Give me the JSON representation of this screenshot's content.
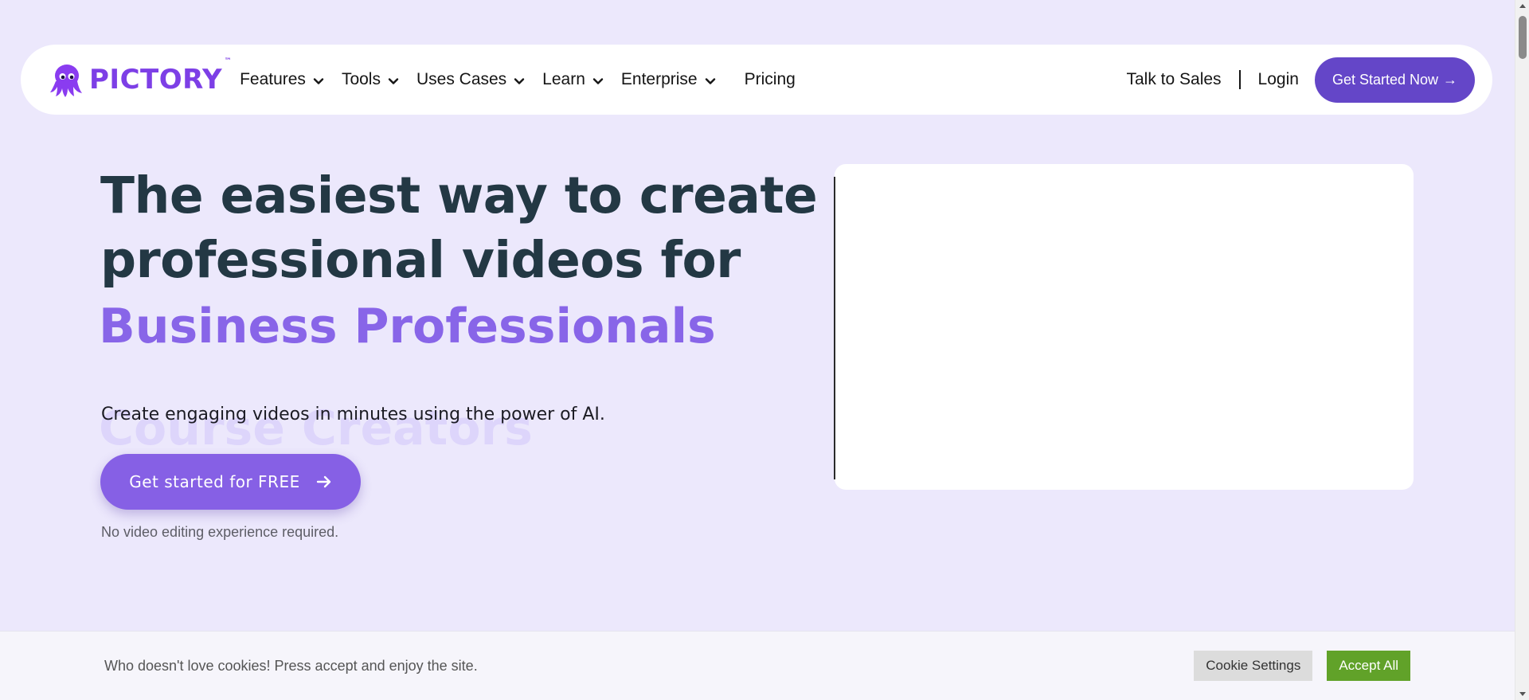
{
  "brand": {
    "name": "PICTORY",
    "tm": "™",
    "primary": "#7d3fe6",
    "accent": "#6446c8"
  },
  "nav": {
    "items": [
      {
        "label": "Features",
        "icon": "chevron-down-icon"
      },
      {
        "label": "Tools",
        "icon": "chevron-down-icon"
      },
      {
        "label": "Uses Cases",
        "icon": "chevron-down-icon"
      },
      {
        "label": "Learn",
        "icon": "chevron-down-icon"
      },
      {
        "label": "Enterprise",
        "icon": "chevron-down-icon"
      }
    ],
    "pricing": "Pricing",
    "talk_to_sales": "Talk to Sales",
    "login": "Login",
    "cta": "Get Started Now",
    "cta_arrow": "→"
  },
  "hero": {
    "title_line1": "The easiest way to create",
    "title_line2": "professional videos for",
    "rotating_current": "Business Professionals",
    "rotating_next": "Course Creators",
    "subtitle": "Create engaging videos in minutes using the power of AI.",
    "cta": "Get started for FREE",
    "note": "No video editing experience required."
  },
  "cookie": {
    "text": "Who doesn't love cookies! Press accept and enjoy the site.",
    "settings": "Cookie Settings",
    "accept": "Accept All"
  }
}
